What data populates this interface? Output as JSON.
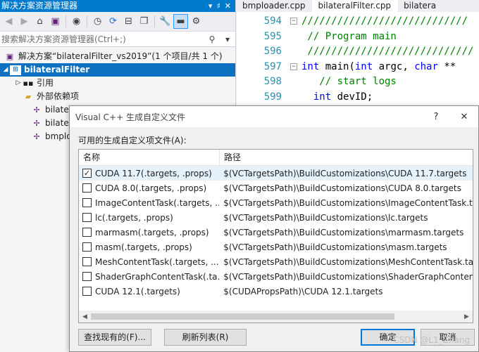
{
  "solution_explorer": {
    "title": "解决方案资源管理器",
    "title_buttons": [
      "▾",
      "♯",
      "✕"
    ],
    "toolbar_icons": [
      "back-icon",
      "forward-icon",
      "home-icon",
      "switch-views-icon",
      "sync-icon",
      "history-icon",
      "refresh-icon",
      "collapse-icon",
      "copy-icon",
      "wrench-icon",
      "minus-icon",
      "properties-icon"
    ],
    "search_placeholder": "搜索解决方案资源管理器(Ctrl+;)",
    "tree": [
      {
        "label": "解决方案“bilateralFilter_vs2019”(1 个项目/共 1 个)",
        "level": 0,
        "icon": "solution-icon"
      },
      {
        "label": "bilateralFilter",
        "level": 0,
        "icon": "project-icon",
        "selected": true
      },
      {
        "label": "引用",
        "level": 1,
        "icon": "references-icon"
      },
      {
        "label": "外部依赖项",
        "level": 1,
        "icon": "external-deps-icon"
      },
      {
        "label": "bilate",
        "level": 1,
        "icon": "cpp-file-icon"
      },
      {
        "label": "bilate",
        "level": 1,
        "icon": "cpp-file-icon"
      },
      {
        "label": "bmplo",
        "level": 1,
        "icon": "cpp-file-icon"
      }
    ]
  },
  "editor": {
    "tabs": [
      "bmploader.cpp",
      "bilateralFilter.cpp",
      "bilatera"
    ],
    "lines": [
      {
        "num": "594",
        "text": "////////////////////////////"
      },
      {
        "num": "595",
        "text": " // Program main"
      },
      {
        "num": "596",
        "text": " ////////////////////////////"
      },
      {
        "num": "597",
        "kw1": "int",
        "rest1": " main(",
        "kw2": "int",
        "rest2": " argc, ",
        "kw3": "char",
        "rest3": " **"
      },
      {
        "num": "598",
        "text": "   // start logs"
      },
      {
        "num": "599",
        "kw1": "int",
        "rest1": " devID;"
      }
    ]
  },
  "dialog": {
    "title": "Visual C++ 生成自定义文件",
    "help": "?",
    "close": "✕",
    "list_label": "可用的生成自定义项文件(A):",
    "columns": [
      "名称",
      "路径"
    ],
    "rows": [
      {
        "checked": true,
        "name": "CUDA 11.7(.targets, .props)",
        "path": "$(VCTargetsPath)\\BuildCustomizations\\CUDA 11.7.targets"
      },
      {
        "checked": false,
        "name": "CUDA 8.0(.targets, .props)",
        "path": "$(VCTargetsPath)\\BuildCustomizations\\CUDA 8.0.targets"
      },
      {
        "checked": false,
        "name": "ImageContentTask(.targets, ...",
        "path": "$(VCTargetsPath)\\BuildCustomizations\\ImageContentTask.targ"
      },
      {
        "checked": false,
        "name": "lc(.targets, .props)",
        "path": "$(VCTargetsPath)\\BuildCustomizations\\lc.targets"
      },
      {
        "checked": false,
        "name": "marmasm(.targets, .props)",
        "path": "$(VCTargetsPath)\\BuildCustomizations\\marmasm.targets"
      },
      {
        "checked": false,
        "name": "masm(.targets, .props)",
        "path": "$(VCTargetsPath)\\BuildCustomizations\\masm.targets"
      },
      {
        "checked": false,
        "name": "MeshContentTask(.targets, ...",
        "path": "$(VCTargetsPath)\\BuildCustomizations\\MeshContentTask.targ"
      },
      {
        "checked": false,
        "name": "ShaderGraphContentTask(.ta...",
        "path": "$(VCTargetsPath)\\BuildCustomizations\\ShaderGraphContentT"
      },
      {
        "checked": false,
        "name": "CUDA 12.1(.targets)",
        "path": "$(CUDAPropsPath)\\CUDA 12.1.targets"
      }
    ],
    "buttons": {
      "find": "查找现有的(F)...",
      "refresh": "刷新列表(R)",
      "ok": "确定",
      "cancel": "取消"
    },
    "watermark": "CSDN @L1_Zhang"
  }
}
